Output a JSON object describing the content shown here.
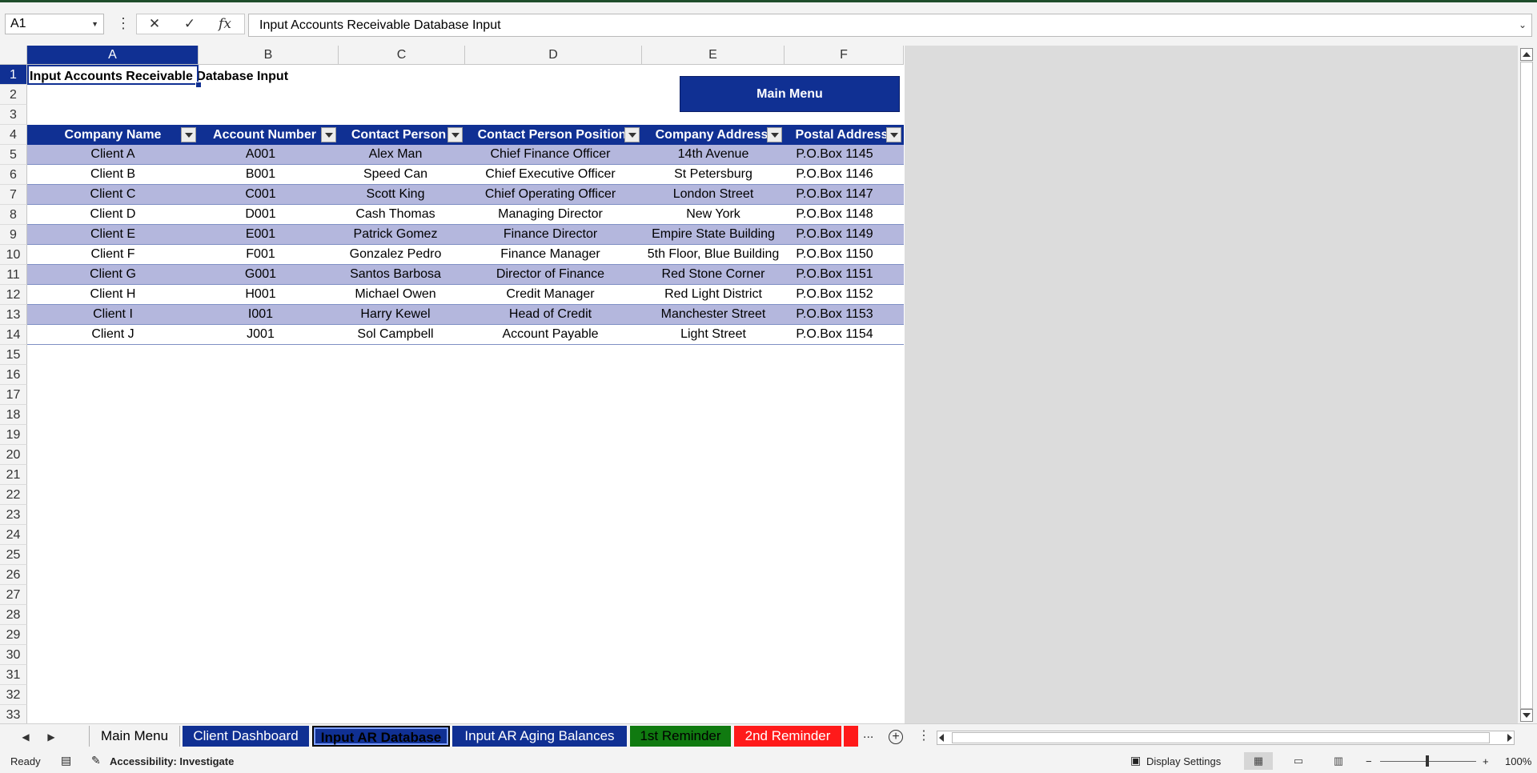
{
  "formula_bar": {
    "name_box": "A1",
    "cancel_icon": "✕",
    "enter_icon": "✓",
    "fx_icon": "fx",
    "formula": "Input Accounts Receivable Database Input"
  },
  "columns": [
    "A",
    "B",
    "C",
    "D",
    "E",
    "F"
  ],
  "rows": [
    "1",
    "2",
    "3",
    "4",
    "5",
    "6",
    "7",
    "8",
    "9",
    "10",
    "11",
    "12",
    "13",
    "14",
    "15",
    "16",
    "17",
    "18",
    "19",
    "20",
    "21",
    "22",
    "23",
    "24",
    "25",
    "26",
    "27",
    "28",
    "29",
    "30",
    "31",
    "32",
    "33"
  ],
  "sheet": {
    "title": "Input Accounts Receivable Database Input",
    "main_menu_button": "Main Menu",
    "table": {
      "headers": [
        "Company Name",
        "Account Number",
        "Contact Person",
        "Contact Person Position",
        "Company Address",
        "Postal Address"
      ],
      "rows": [
        [
          "Client A",
          "A001",
          "Alex Man",
          "Chief Finance Officer",
          "14th Avenue",
          "P.O.Box 1145"
        ],
        [
          "Client B",
          "B001",
          "Speed Can",
          "Chief Executive Officer",
          "St Petersburg",
          "P.O.Box 1146"
        ],
        [
          "Client C",
          "C001",
          "Scott King",
          "Chief Operating Officer",
          "London Street",
          "P.O.Box 1147"
        ],
        [
          "Client D",
          "D001",
          "Cash Thomas",
          "Managing Director",
          "New York",
          "P.O.Box 1148"
        ],
        [
          "Client E",
          "E001",
          "Patrick Gomez",
          "Finance Director",
          "Empire State Building",
          "P.O.Box 1149"
        ],
        [
          "Client F",
          "F001",
          "Gonzalez Pedro",
          "Finance Manager",
          "5th Floor, Blue Building",
          "P.O.Box 1150"
        ],
        [
          "Client G",
          "G001",
          "Santos Barbosa",
          "Director of Finance",
          "Red Stone Corner",
          "P.O.Box 1151"
        ],
        [
          "Client H",
          "H001",
          "Michael Owen",
          "Credit Manager",
          "Red Light District",
          "P.O.Box 1152"
        ],
        [
          "Client I",
          "I001",
          "Harry Kewel",
          "Head of Credit",
          "Manchester Street",
          "P.O.Box 1153"
        ],
        [
          "Client J",
          "J001",
          "Sol Campbell",
          "Account Payable",
          "Light Street",
          "P.O.Box 1154"
        ]
      ]
    }
  },
  "tabs": {
    "items": [
      "Main Menu",
      "Client Dashboard",
      "Input AR Database",
      "Input AR Aging Balances",
      "1st Reminder",
      "2nd Reminder"
    ],
    "more": "...",
    "add": "+",
    "colors": {
      "blue": "#103093",
      "green": "#107a10",
      "red": "#ff1a1a"
    }
  },
  "status": {
    "ready": "Ready",
    "accessibility": "Accessibility: Investigate",
    "display_settings": "Display Settings",
    "zoom_minus": "−",
    "zoom_plus": "+",
    "zoom": "100%"
  }
}
